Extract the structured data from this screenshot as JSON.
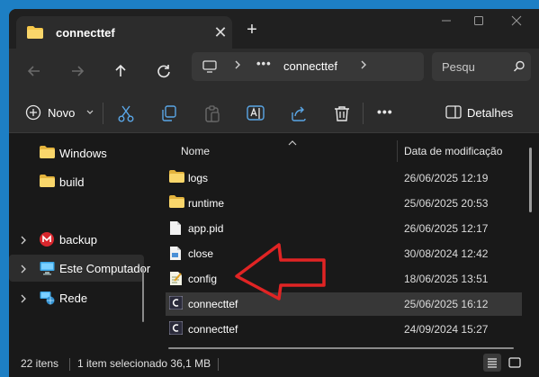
{
  "window": {
    "tab_title": "connecttef",
    "tab_close": "✕",
    "new_tab": "+"
  },
  "address_bar": {
    "overflow_dots": "•••",
    "crumb": "connecttef",
    "search_placeholder": "Pesqu"
  },
  "command_bar": {
    "new_label": "Novo",
    "details_label": "Detalhes",
    "more": "•••"
  },
  "sidebar": {
    "items": [
      {
        "label": "Windows",
        "icon": "folder-icon"
      },
      {
        "label": "build",
        "icon": "folder-icon"
      },
      {
        "label": "backup",
        "icon": "mega-icon"
      },
      {
        "label": "Este Computador",
        "icon": "this-pc-icon"
      },
      {
        "label": "Rede",
        "icon": "network-icon"
      }
    ]
  },
  "file_list": {
    "columns": {
      "name": "Nome",
      "date": "Data de modificação"
    },
    "rows": [
      {
        "name": "logs",
        "date": "26/06/2025 12:19",
        "icon": "folder-icon"
      },
      {
        "name": "runtime",
        "date": "25/06/2025 20:53",
        "icon": "folder-icon"
      },
      {
        "name": "app.pid",
        "date": "26/06/2025 12:17",
        "icon": "file-icon"
      },
      {
        "name": "close",
        "date": "30/08/2024 12:42",
        "icon": "script-file-icon"
      },
      {
        "name": "config",
        "date": "18/06/2025 13:51",
        "icon": "config-file-icon"
      },
      {
        "name": "connecttef",
        "date": "25/06/2025 16:12",
        "icon": "app-icon",
        "selected": true
      },
      {
        "name": "connecttef",
        "date": "24/09/2024 15:27",
        "icon": "app-icon"
      }
    ]
  },
  "status_bar": {
    "count": "22 itens",
    "selection": "1 item selecionado 36,1 MB"
  },
  "colors": {
    "window_bg": "#191919",
    "toolbar_bg": "#2c2c2c",
    "folder_yellow": "#f6c84a",
    "selected_row": "#373737",
    "annotation_red": "#e02424",
    "desktop_blue": "#1d7fc4"
  }
}
